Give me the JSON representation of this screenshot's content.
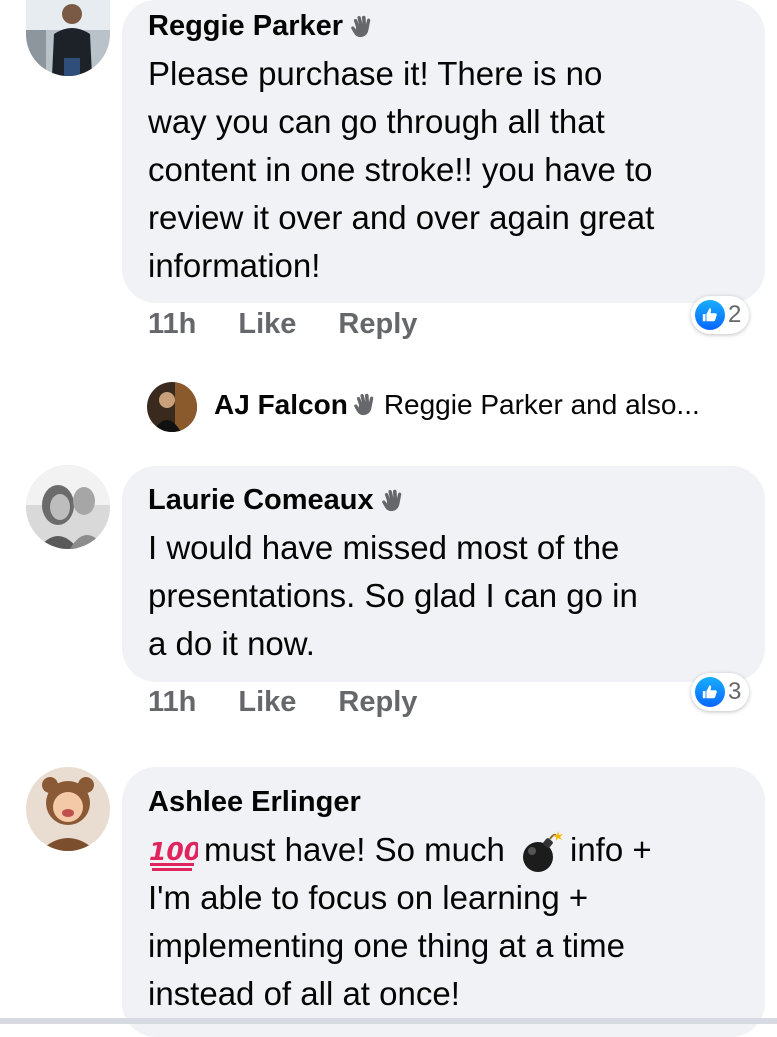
{
  "comments": [
    {
      "author": "Reggie Parker",
      "lines": [
        "Please purchase it! There is no",
        "way you can go through all that",
        "content in one stroke!! you have to",
        "review it over and over again great",
        "information!"
      ],
      "time": "11h",
      "like_label": "Like",
      "reply_label": "Reply",
      "reaction_count": "2"
    },
    {
      "author": "Laurie Comeaux",
      "lines": [
        "I would have missed most of the",
        "presentations. So glad I can go in",
        "a do it now."
      ],
      "time": "11h",
      "like_label": "Like",
      "reply_label": "Reply",
      "reaction_count": "3"
    },
    {
      "author": "Ashlee Erlinger",
      "line1_part1": "must have! So much",
      "line1_part2": "info +",
      "lines": [
        "I'm able to focus on learning +",
        "implementing one thing at a time",
        "instead of all at once!"
      ]
    }
  ],
  "reply_preview": {
    "author": "AJ Falcon",
    "snippet": "Reggie Parker and also..."
  },
  "icons": {
    "badge": "waving-hand-icon",
    "reaction": "like-icon",
    "hundred": "hundred-points-emoji",
    "bomb": "bomb-emoji"
  },
  "colors": {
    "bubble": "#f0f2f5",
    "meta_text": "#65676b",
    "like_blue": "#0866ff"
  }
}
